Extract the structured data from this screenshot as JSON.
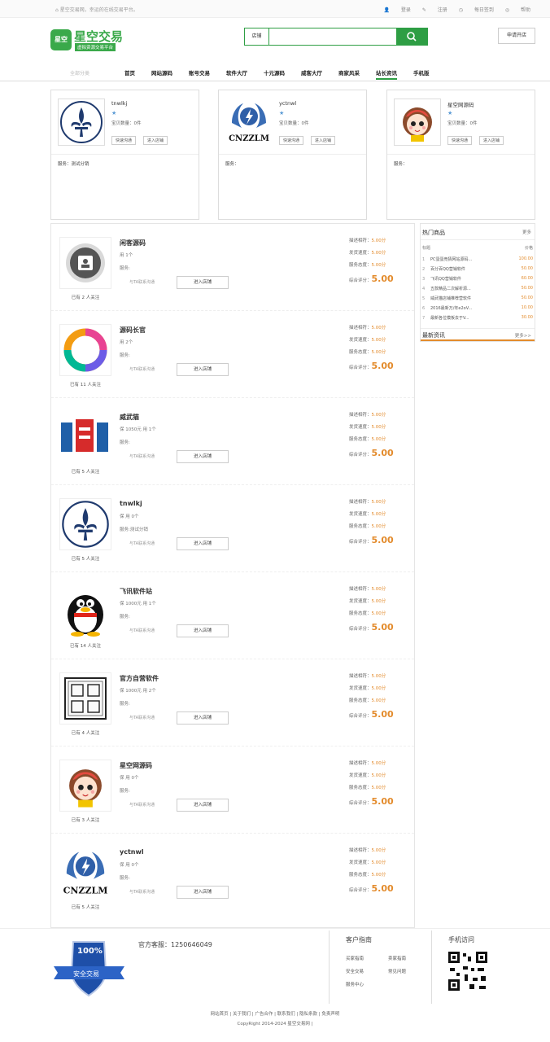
{
  "topbar": {
    "welcome": "星空交易网，幸运的在线交易平台。",
    "login": "登录",
    "register": "注册",
    "signin": "每日签到",
    "help": "帮助"
  },
  "header": {
    "logo_badge": "星空",
    "logo_name": "星空交易",
    "logo_slogan": "虚拟资源交易平台",
    "search_category": "店铺",
    "search_placeholder": "",
    "apply_button": "申请开店"
  },
  "nav": {
    "all_categories": "全部分类",
    "items": [
      "首页",
      "网站源码",
      "账号交易",
      "软件大厅",
      "十元源码",
      "威客大厅",
      "商家风采",
      "站长资讯",
      "手机版"
    ]
  },
  "top_shops": [
    {
      "name": "tnwlkj",
      "star": "★",
      "count": "宝贝数量：0件",
      "btn_contact": "快速沟通",
      "btn_enter": "进入店铺",
      "service": "服务：测试分销"
    },
    {
      "name": "yctnwl",
      "star": "★",
      "count": "宝贝数量：0件",
      "btn_contact": "快速沟通",
      "btn_enter": "进入店铺",
      "service": "服务："
    },
    {
      "name": "星空网源码",
      "star": "★",
      "count": "宝贝数量：0件",
      "btn_contact": "快速沟通",
      "btn_enter": "进入店铺",
      "service": "服务："
    }
  ],
  "shop_list": {
    "contact_label": "与TA联系沟通",
    "enter_label": "进入店铺",
    "score_labels": [
      "描述相符：",
      "发货速度：",
      "服务态度："
    ],
    "total_label": "综合评分：",
    "rows": [
      {
        "name": "闲客源码",
        "meta": "用  1个",
        "service": "服务:",
        "followers": "已有 2 人关注",
        "s1": "5.00分",
        "s2": "5.00分",
        "s3": "5.00分",
        "total": "5.00"
      },
      {
        "name": "源码长官",
        "meta": "用  2个",
        "service": "服务:",
        "followers": "已有 11 人关注",
        "s1": "5.00分",
        "s2": "5.00分",
        "s3": "5.00分",
        "total": "5.00"
      },
      {
        "name": "威武猫",
        "meta": "保  1050元  用  1个",
        "service": "服务:",
        "followers": "已有 5 人关注",
        "s1": "5.00分",
        "s2": "5.00分",
        "s3": "5.00分",
        "total": "5.00"
      },
      {
        "name": "tnwlkj",
        "meta": "保  用  0个",
        "service": "服务:测试分销",
        "followers": "已有 5 人关注",
        "s1": "5.00分",
        "s2": "5.00分",
        "s3": "5.00分",
        "total": "5.00"
      },
      {
        "name": "飞讯软件站",
        "meta": "保  1000元  用  1个",
        "service": "服务:",
        "followers": "已有 14 人关注",
        "s1": "5.00分",
        "s2": "5.00分",
        "s3": "5.00分",
        "total": "5.00"
      },
      {
        "name": "官方自营软件",
        "meta": "保  1000元  用  2个",
        "service": "服务:",
        "followers": "已有 4 人关注",
        "s1": "5.00分",
        "s2": "5.00分",
        "s3": "5.00分",
        "total": "5.00"
      },
      {
        "name": "星空网源码",
        "meta": "保  用  0个",
        "service": "服务:",
        "followers": "已有 3 人关注",
        "s1": "5.00分",
        "s2": "5.00分",
        "s3": "5.00分",
        "total": "5.00"
      },
      {
        "name": "yctnwl",
        "meta": "保  用  0个",
        "service": "服务:",
        "followers": "已有 5 人关注",
        "s1": "5.00分",
        "s2": "5.00分",
        "s3": "5.00分",
        "total": "5.00"
      }
    ]
  },
  "sidebar": {
    "hot_title": "热门商品",
    "hot_more": "更多",
    "col_title": "标题",
    "col_price": "价格",
    "items": [
      {
        "idx": "1",
        "title": "PC蛋蛋竞猜网站源码...",
        "price": "100.00"
      },
      {
        "idx": "2",
        "title": "百分百QQ营销软件",
        "price": "50.00"
      },
      {
        "idx": "3",
        "title": "飞讯QQ营销软件",
        "price": "60.00"
      },
      {
        "idx": "4",
        "title": "五款精品二次解析源...",
        "price": "50.00"
      },
      {
        "idx": "5",
        "title": "威武猫店铺推荐营软件",
        "price": "50.00"
      },
      {
        "idx": "6",
        "title": "2016最新万/年e2oV...",
        "price": "10.00"
      },
      {
        "idx": "7",
        "title": "最新各位模板去于V...",
        "price": "30.00"
      }
    ],
    "news_title": "最新资讯",
    "news_more": "更多>>"
  },
  "footer": {
    "shield_pct": "100%",
    "shield_text": "安全交易",
    "service_phone": "官方客服：1250646049",
    "guide_title": "客户指南",
    "guide_links": [
      "买家指南",
      "卖家指南",
      "安全交易",
      "常见问题",
      "服务中心"
    ],
    "mobile_title": "手机访问",
    "bottom_links": "网站首页 | 关于我们 | 广告合作 | 联系我们 | 隐私条款 | 免责声明",
    "copyright": "CopyRight 2014-2024 星空交易网 |"
  },
  "colors": {
    "brand_green": "#2e9e44",
    "score_orange": "#e38b2c",
    "star_blue": "#5b9bd5"
  }
}
